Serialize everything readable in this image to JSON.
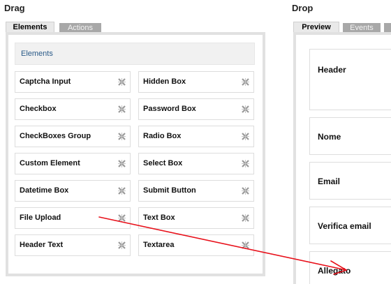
{
  "drag": {
    "heading": "Drag",
    "tabs": [
      {
        "label": "Elements",
        "active": true
      },
      {
        "label": "Actions",
        "active": false
      }
    ],
    "panel_header": "Elements",
    "elements_left": [
      "Captcha Input",
      "Checkbox",
      "CheckBoxes Group",
      "Custom Element",
      "Datetime Box",
      "File Upload",
      "Header Text"
    ],
    "elements_right": [
      "Hidden Box",
      "Password Box",
      "Radio Box",
      "Select Box",
      "Submit Button",
      "Text Box",
      "Textarea"
    ],
    "move_icon": "move-cross-icon"
  },
  "drop": {
    "heading": "Drop",
    "tabs": [
      {
        "label": "Preview",
        "active": true
      },
      {
        "label": "Events",
        "active": false
      },
      {
        "label": "",
        "active": false
      }
    ],
    "fields": [
      "Header",
      "Nome",
      "Email",
      "Verifica email",
      "Allegato"
    ]
  },
  "annotation": {
    "arrow_color": "#e8101a",
    "description_icon": "drag-arrow-icon"
  },
  "colors": {
    "panel_border": "#e1e1e1",
    "inactive_tab": "#a8a8a8",
    "header_link": "#2a5a88"
  }
}
